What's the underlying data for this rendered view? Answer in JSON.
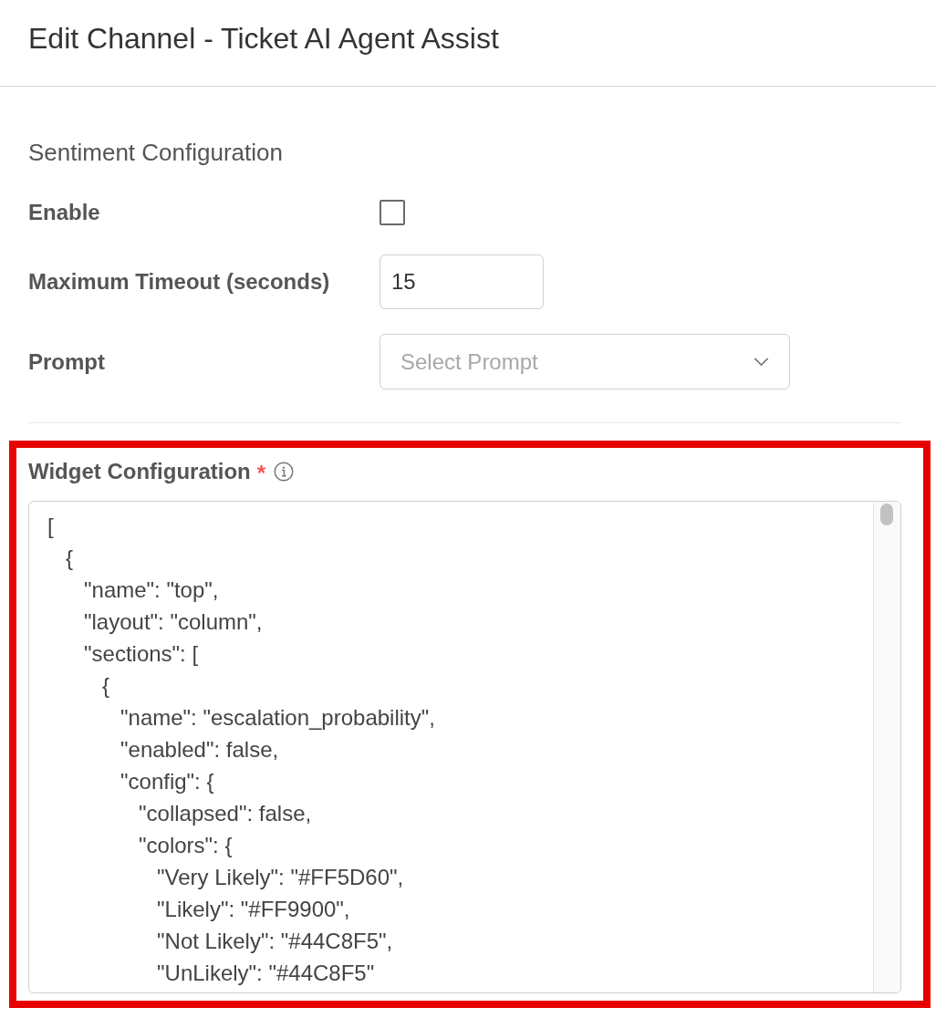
{
  "header": {
    "title": "Edit Channel - Ticket AI Agent Assist"
  },
  "sentiment_configuration": {
    "title": "Sentiment Configuration",
    "fields": [
      {
        "kind": "checkbox",
        "label": "Enable",
        "checked": false
      },
      {
        "kind": "number",
        "label": "Maximum Timeout (seconds)",
        "value": "15"
      },
      {
        "kind": "select",
        "label": "Prompt",
        "placeholder": "Select Prompt"
      }
    ]
  },
  "widget_configuration": {
    "highlighted": true,
    "label": "Widget Configuration",
    "required_mark": "*",
    "value": "[\n   {\n      \"name\": \"top\",\n      \"layout\": \"column\",\n      \"sections\": [\n         {\n            \"name\": \"escalation_probability\",\n            \"enabled\": false,\n            \"config\": {\n               \"collapsed\": false,\n               \"colors\": {\n                  \"Very Likely\": \"#FF5D60\",\n                  \"Likely\": \"#FF9900\",\n                  \"Not Likely\": \"#44C8F5\",\n                  \"UnLikely\": \"#44C8F5\""
  }
}
